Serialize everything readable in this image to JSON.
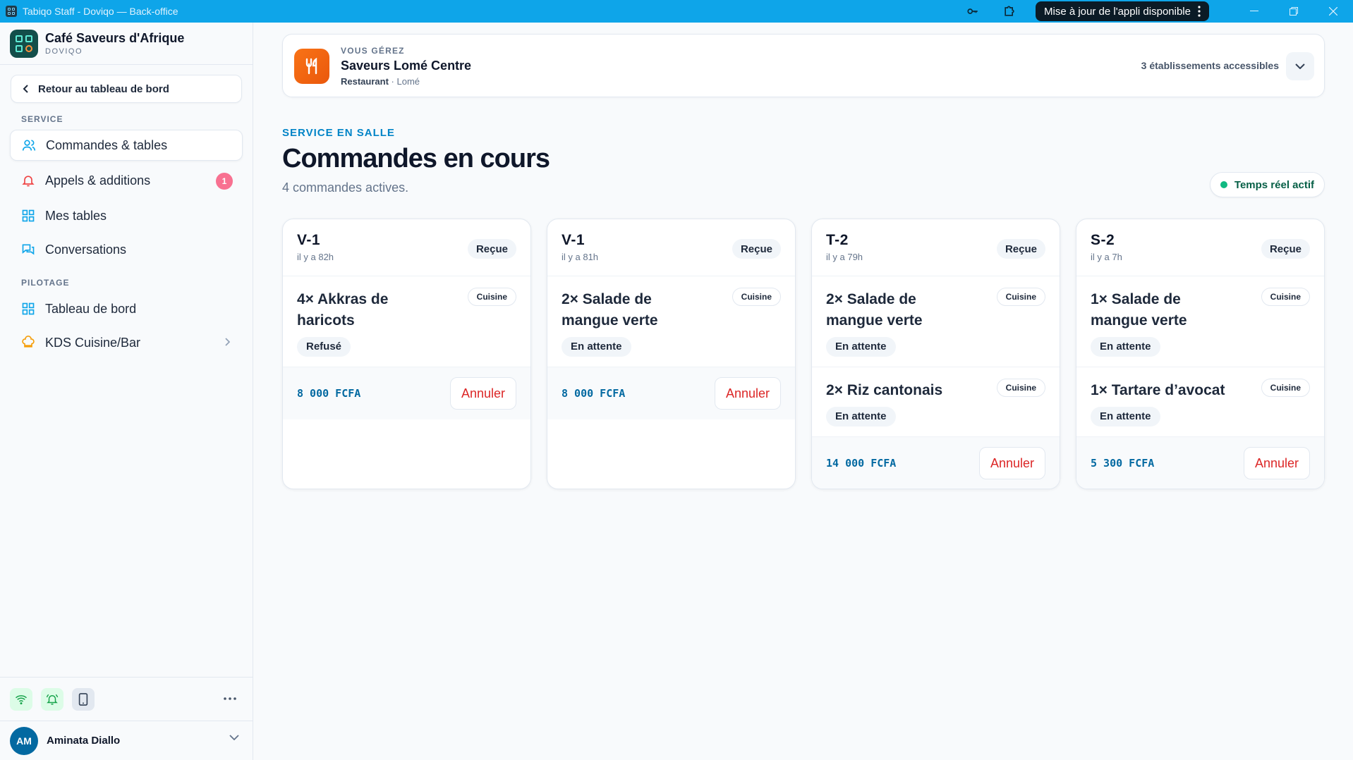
{
  "window": {
    "title": "Tabiqo Staff - Doviqo — Back-office",
    "update_label": "Mise à jour de l'appli disponible",
    "icons": [
      "key-icon",
      "extension-icon",
      "more-vertical-icon",
      "minimize-icon",
      "restore-icon",
      "close-icon"
    ]
  },
  "colors": {
    "titlebar": "#0ea5e9",
    "accent": "#0284c7",
    "danger": "#dc2626",
    "live": "#10b981",
    "badge": "#f87191"
  },
  "sidebar": {
    "brand": {
      "name": "Café Saveurs d'Afrique",
      "sub": "DOVIQO"
    },
    "back_label": "Retour au tableau de bord",
    "sections": [
      {
        "label": "SERVICE",
        "items": [
          {
            "label": "Commandes & tables",
            "icon": "users-icon",
            "active": true
          },
          {
            "label": "Appels & additions",
            "icon": "bell-icon",
            "badge": "1"
          },
          {
            "label": "Mes tables",
            "icon": "grid-icon"
          },
          {
            "label": "Conversations",
            "icon": "chat-icon"
          }
        ]
      },
      {
        "label": "PILOTAGE",
        "items": [
          {
            "label": "Tableau de bord",
            "icon": "dashboard-icon"
          },
          {
            "label": "KDS Cuisine/Bar",
            "icon": "chef-hat-icon",
            "has_submenu": true
          }
        ]
      }
    ],
    "footer_icons": [
      "wifi-icon",
      "bell-ring-icon",
      "tablet-icon",
      "more-horizontal-icon"
    ],
    "user": {
      "initials": "AM",
      "name": "Aminata Diallo"
    }
  },
  "establishment": {
    "kicker": "VOUS GÉREZ",
    "name": "Saveurs Lomé Centre",
    "type": "Restaurant",
    "separator": "·",
    "city": "Lomé",
    "accessible_count": "3 établissements accessibles"
  },
  "page": {
    "kicker": "SERVICE EN SALLE",
    "title": "Commandes en cours",
    "subtitle": "4 commandes actives.",
    "live_label": "Temps réel actif"
  },
  "orders": [
    {
      "table": "V-1",
      "age": "il y a 82h",
      "status": "Reçue",
      "items": [
        {
          "name": "4× Akkras de haricots",
          "station": "Cuisine",
          "status": "Refusé"
        }
      ],
      "total": "8 000 FCFA",
      "cancel_label": "Annuler"
    },
    {
      "table": "V-1",
      "age": "il y a 81h",
      "status": "Reçue",
      "items": [
        {
          "name": "2× Salade de mangue verte",
          "station": "Cuisine",
          "status": "En attente"
        }
      ],
      "total": "8 000 FCFA",
      "cancel_label": "Annuler"
    },
    {
      "table": "T-2",
      "age": "il y a 79h",
      "status": "Reçue",
      "items": [
        {
          "name": "2× Salade de mangue verte",
          "station": "Cuisine",
          "status": "En attente"
        },
        {
          "name": "2× Riz cantonais",
          "station": "Cuisine",
          "status": "En attente"
        }
      ],
      "total": "14 000 FCFA",
      "cancel_label": "Annuler"
    },
    {
      "table": "S-2",
      "age": "il y a 7h",
      "status": "Reçue",
      "items": [
        {
          "name": "1× Salade de mangue verte",
          "station": "Cuisine",
          "status": "En attente"
        },
        {
          "name": "1× Tartare d’avocat",
          "station": "Cuisine",
          "status": "En attente"
        }
      ],
      "total": "5 300 FCFA",
      "cancel_label": "Annuler"
    }
  ]
}
